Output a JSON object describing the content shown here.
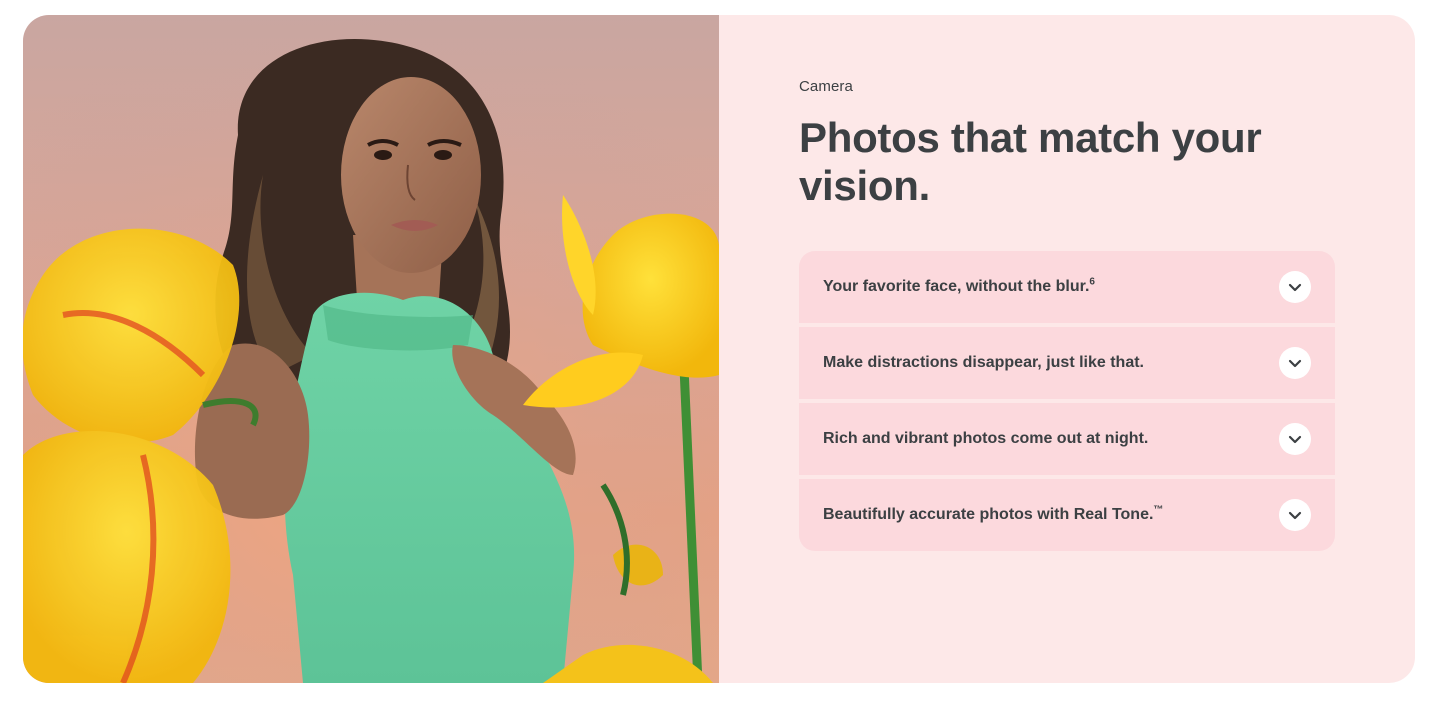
{
  "section": {
    "eyebrow": "Camera",
    "headline": "Photos that match your vision."
  },
  "accordion": {
    "items": [
      {
        "label": "Your favorite face, without the blur.",
        "sup": "6",
        "icon": "chevron-down-icon",
        "expanded": false
      },
      {
        "label": "Make distractions disappear, just like that.",
        "sup": "",
        "icon": "chevron-down-icon",
        "expanded": false
      },
      {
        "label": "Rich and vibrant photos come out at night.",
        "sup": "",
        "icon": "chevron-down-icon",
        "expanded": false
      },
      {
        "label": "Beautifully accurate photos with Real Tone.",
        "sup": "™",
        "icon": "chevron-down-icon",
        "expanded": false
      }
    ]
  },
  "image": {
    "subject": "woman-in-green-top-with-yellow-tulips"
  },
  "colors": {
    "card_background": "#fde8e8",
    "accordion_item": "#fcd9dd",
    "text": "#3c4043",
    "chevron_bg": "#ffffff"
  }
}
